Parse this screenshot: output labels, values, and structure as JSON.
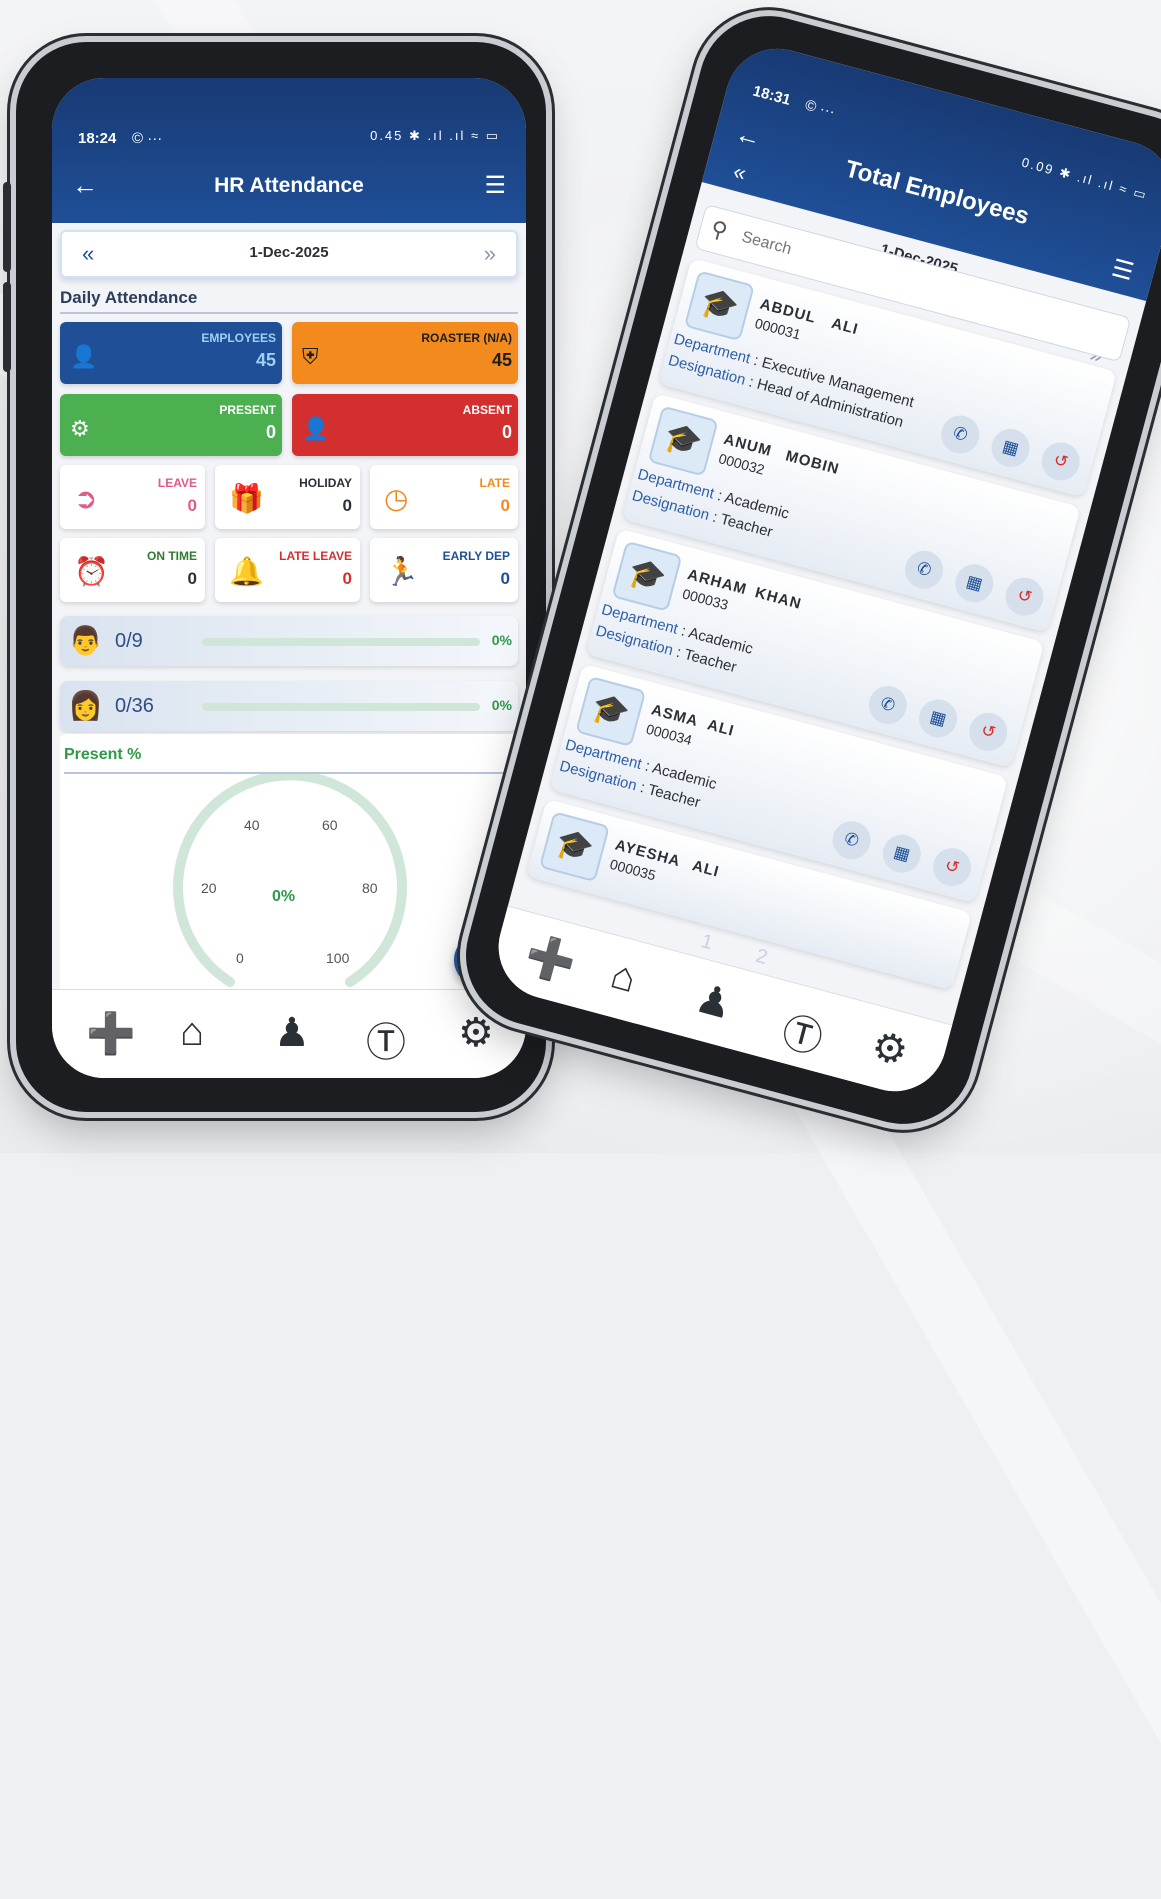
{
  "left_phone": {
    "status_time": "18:24",
    "status_icons_left": "© ···",
    "status_icons_right": "0.45 ✱ .ıl .ıl ≈ ▭",
    "title": "HR Attendance",
    "date": "1-Dec-2025",
    "section_title": "Daily Attendance",
    "tiles": [
      {
        "label": "EMPLOYEES",
        "value": "45",
        "color": "#1f4f97"
      },
      {
        "label": "ROASTER (N/A)",
        "value": "45",
        "color": "#f28a1d"
      },
      {
        "label": "PRESENT",
        "value": "0",
        "color": "#4caf50"
      },
      {
        "label": "ABSENT",
        "value": "0",
        "color": "#d32f2f"
      }
    ],
    "small_tiles": [
      {
        "label": "LEAVE",
        "value": "0",
        "color": "#e05a8a"
      },
      {
        "label": "HOLIDAY",
        "value": "0",
        "color": "#2b2f36"
      },
      {
        "label": "LATE",
        "value": "0",
        "color": "#f28a1d"
      },
      {
        "label": "ON TIME",
        "value": "0",
        "color": "#2e7d32"
      },
      {
        "label": "LATE LEAVE",
        "value": "0",
        "color": "#d32f2f"
      },
      {
        "label": "EARLY DEP",
        "value": "0",
        "color": "#1f4f97"
      }
    ],
    "progress": [
      {
        "count": "0/9",
        "percent_text": "0%",
        "fraction": 0
      },
      {
        "count": "0/36",
        "percent_text": "0%",
        "fraction": 0
      }
    ],
    "gauge": {
      "title": "Present %",
      "value_text": "0%",
      "value": 0,
      "ticks": [
        "0",
        "20",
        "40",
        "60",
        "80",
        "100"
      ]
    }
  },
  "right_phone": {
    "status_time": "18:31",
    "status_icons_left": "© ···",
    "status_icons_right": "0.09 ✱ .ıl .ıl ≈ ▭",
    "title": "Total Employees",
    "date": "1-Dec-2025",
    "search_placeholder": "Search",
    "department_label": "Department",
    "designation_label": "Designation",
    "employees": [
      {
        "first": "ABDUL",
        "last": "ALI",
        "id": "000031",
        "department": "Executive Management",
        "designation": "Head of Administration"
      },
      {
        "first": "ANUM",
        "last": "MOBIN",
        "id": "000032",
        "department": "Academic",
        "designation": "Teacher"
      },
      {
        "first": "ARHAM",
        "last": "KHAN",
        "id": "000033",
        "department": "Academic",
        "designation": "Teacher"
      },
      {
        "first": "ASMA",
        "last": "ALI",
        "id": "000034",
        "department": "Academic",
        "designation": "Teacher"
      },
      {
        "first": "AYESHA",
        "last": "ALI",
        "id": "000035",
        "department": "",
        "designation": ""
      }
    ],
    "pages": [
      "1",
      "2"
    ]
  },
  "colors": {
    "header_blue": "#1f4f97",
    "accent_green": "#2f9a47",
    "gauge_track": "#cfe6d8"
  }
}
